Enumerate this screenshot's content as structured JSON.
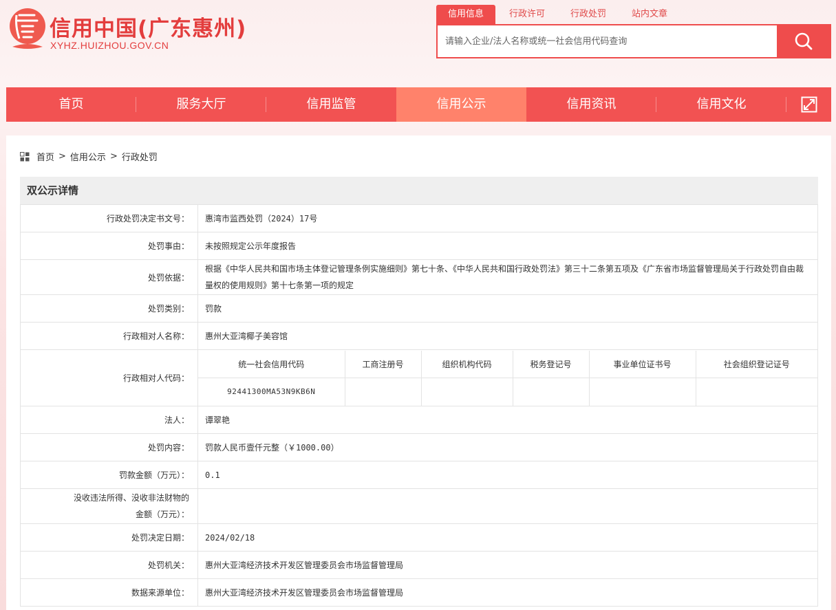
{
  "site": {
    "title": "信用中国(广东惠州)",
    "domain": "XYHZ.HUIZHOU.GOV.CN",
    "brand_color": "#ef4c4c"
  },
  "search": {
    "tabs": [
      "信用信息",
      "行政许可",
      "行政处罚",
      "站内文章"
    ],
    "active_tab": "信用信息",
    "placeholder": "请输入企业/法人名称或统一社会信用代码查询",
    "button_icon": "search-icon"
  },
  "nav": {
    "items": [
      "首页",
      "服务大厅",
      "信用监管",
      "信用公示",
      "信用资讯",
      "信用文化"
    ],
    "active": "信用公示",
    "expand_icon": "expand-icon"
  },
  "breadcrumb": {
    "icon": "grid-icon",
    "items": [
      "首页",
      "信用公示",
      "行政处罚"
    ],
    "separator": ">"
  },
  "detail": {
    "section_title": "双公示详情",
    "rows": {
      "doc_no": {
        "label": "行政处罚决定书文号：",
        "value": "惠湾市监西处罚（2024）17号"
      },
      "reason": {
        "label": "处罚事由：",
        "value": "未按照规定公示年度报告"
      },
      "basis": {
        "label": "处罚依据：",
        "value": "根据《中华人民共和国市场主体登记管理条例实施细则》第七十条、《中华人民共和国行政处罚法》第三十二条第五项及《广东省市场监督管理局关于行政处罚自由裁量权的使用规则》第十七条第一项的规定"
      },
      "category": {
        "label": "处罚类别：",
        "value": "罚款"
      },
      "party_name": {
        "label": "行政相对人名称：",
        "value": "惠州大亚湾椰子美容馆"
      },
      "party_code": {
        "label": "行政相对人代码："
      },
      "legal_person": {
        "label": "法人：",
        "value": "谭翠艳"
      },
      "content": {
        "label": "处罚内容：",
        "value": "罚款人民币壹仟元整（￥1000.00）"
      },
      "fine": {
        "label": "罚款金额（万元）：",
        "value": "0.1"
      },
      "confiscation": {
        "label_line1": "没收违法所得、没收非法财物的",
        "label_line2": "金额（万元）：",
        "value": ""
      },
      "decision_date": {
        "label": "处罚决定日期：",
        "value": "2024/02/18"
      },
      "authority": {
        "label": "处罚机关：",
        "value": "惠州大亚湾经济技术开发区管理委员会市场监督管理局"
      },
      "source": {
        "label": "数据来源单位：",
        "value": "惠州大亚湾经济技术开发区管理委员会市场监督管理局"
      }
    },
    "codes": {
      "headers": [
        "统一社会信用代码",
        "工商注册号",
        "组织机构代码",
        "税务登记号",
        "事业单位证书号",
        "社会组织登记证号"
      ],
      "values": [
        "92441300MA53N9KB6N",
        "",
        "",
        "",
        "",
        ""
      ]
    }
  }
}
